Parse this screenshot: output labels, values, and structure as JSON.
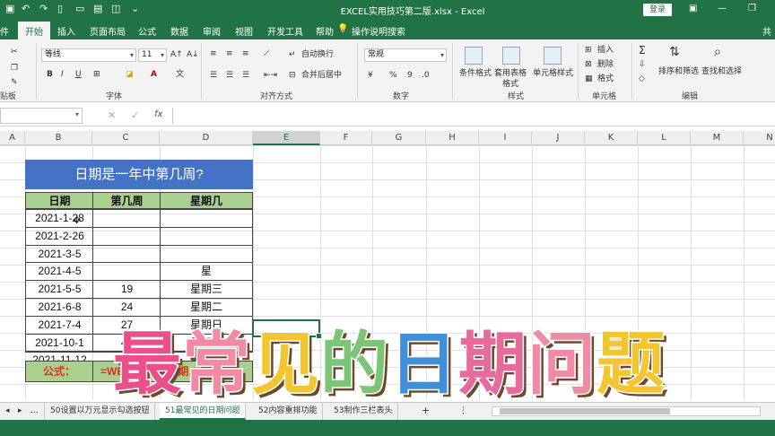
{
  "window": {
    "title": "EXCEL实用技巧第二版.xlsx - Excel",
    "login_label": "登录",
    "qa_icons": [
      "save-icon",
      "undo-icon",
      "redo-icon",
      "new-file-icon",
      "open-folder-icon",
      "print-preview-icon",
      "spellcheck-icon",
      "customize-icon"
    ]
  },
  "ribbon_tabs": [
    {
      "label": "开始",
      "active": true
    },
    {
      "label": "插入"
    },
    {
      "label": "页面布局"
    },
    {
      "label": "公式"
    },
    {
      "label": "数据"
    },
    {
      "label": "审阅"
    },
    {
      "label": "视图"
    },
    {
      "label": "开发工具"
    },
    {
      "label": "帮助"
    }
  ],
  "search_tell": "操作说明搜索",
  "share_label": "共",
  "ribbon": {
    "font_name": "等线",
    "font_size": "11",
    "wrap_text": "自动换行",
    "merge_center": "合并后居中",
    "number_format": "常规",
    "cond_format": "条件格式",
    "table_format": "套用表格格式",
    "cell_style": "单元格样式",
    "insert": "插入",
    "delete": "删除",
    "format": "格式",
    "sort_filter": "排序和筛选",
    "find_select": "查找和选择",
    "groups": {
      "clipboard": "贴板",
      "font": "字体",
      "align": "对齐方式",
      "number": "数字",
      "styles": "样式",
      "cells": "单元格",
      "edit": "编辑"
    },
    "bold": "B",
    "italic": "I",
    "underline": "U",
    "percent": "%",
    "comma": "9"
  },
  "formula_bar": {
    "fx": "fx",
    "content": ""
  },
  "columns": [
    "A",
    "B",
    "C",
    "D",
    "E",
    "F",
    "G",
    "H",
    "I",
    "J",
    "K",
    "L",
    "M",
    "N"
  ],
  "selected_column": "E",
  "table": {
    "title": "日期是一年中第几周?",
    "headers": [
      "日期",
      "第几周",
      "星期几"
    ],
    "rows": [
      [
        "2021-1-28",
        "",
        ""
      ],
      [
        "2021-2-26",
        "",
        ""
      ],
      [
        "2021-3-5",
        "",
        ""
      ],
      [
        "2021-4-5",
        "",
        "星"
      ],
      [
        "2021-5-5",
        "19",
        "星期三"
      ],
      [
        "2021-6-8",
        "24",
        "星期二"
      ],
      [
        "2021-7-4",
        "27",
        "星期日"
      ],
      [
        "2021-10-1",
        "40",
        "星期五"
      ],
      [
        "2021-11-12",
        "46",
        "星期五"
      ]
    ],
    "formula_label": "公式：",
    "formula_text": "=WEEKNUM(日期,2)"
  },
  "overlay": {
    "chars": [
      {
        "ch": "最",
        "color": "#e8508a"
      },
      {
        "ch": "常",
        "color": "#f08aa6"
      },
      {
        "ch": "见",
        "color": "#f3c531"
      },
      {
        "ch": "的",
        "color": "#7cc576"
      },
      {
        "ch": "日",
        "color": "#3f8fd9"
      },
      {
        "ch": "期",
        "color": "#e66a9c"
      },
      {
        "ch": "问",
        "color": "#f08aa6"
      },
      {
        "ch": "题",
        "color": "#f3c531"
      }
    ]
  },
  "sheet_tabs": [
    {
      "label": "..."
    },
    {
      "label": "50设置以万元显示勾选按钮"
    },
    {
      "label": "51最常见的日期问题",
      "active": true
    },
    {
      "label": "52内容重排功能"
    },
    {
      "label": "53制作三栏表头"
    }
  ],
  "add_sheet": "+"
}
